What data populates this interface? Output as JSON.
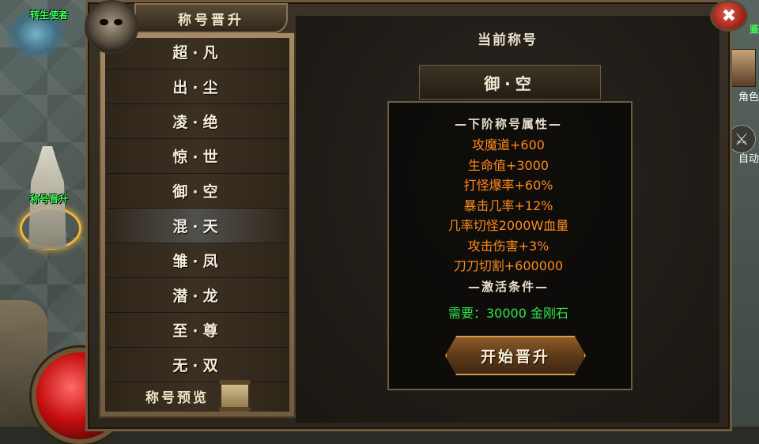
{
  "world": {
    "npc_top_label": "转生使者",
    "npc_label": "称号晋升",
    "right_label_top": "鉴",
    "right_label_1": "角色",
    "right_label_2": "自动"
  },
  "panel": {
    "title": "称号晋升",
    "ranks": [
      "超·凡",
      "出·尘",
      "凌·绝",
      "惊·世",
      "御·空",
      "混·天",
      "雏·凤",
      "潜·龙",
      "至·尊",
      "无·双"
    ],
    "selected_index": 5,
    "preview_label": "称号预览",
    "current_label": "当前称号",
    "current_title": "御·空",
    "next_attr_title": "—下阶称号属性—",
    "attributes": [
      "攻魔道+600",
      "生命值+3000",
      "打怪爆率+60%",
      "暴击几率+12%",
      "几率切怪2000W血量",
      "攻击伤害+3%",
      "刀刀切割+600000"
    ],
    "activate_title": "—激活条件—",
    "requirement": "需要：30000 金刚石",
    "start_button": "开始晋升",
    "close_icon": "✖"
  },
  "colors": {
    "attribute": "#ff8a1a",
    "requirement": "#2fe64a",
    "npc_label": "#3cff5a"
  }
}
